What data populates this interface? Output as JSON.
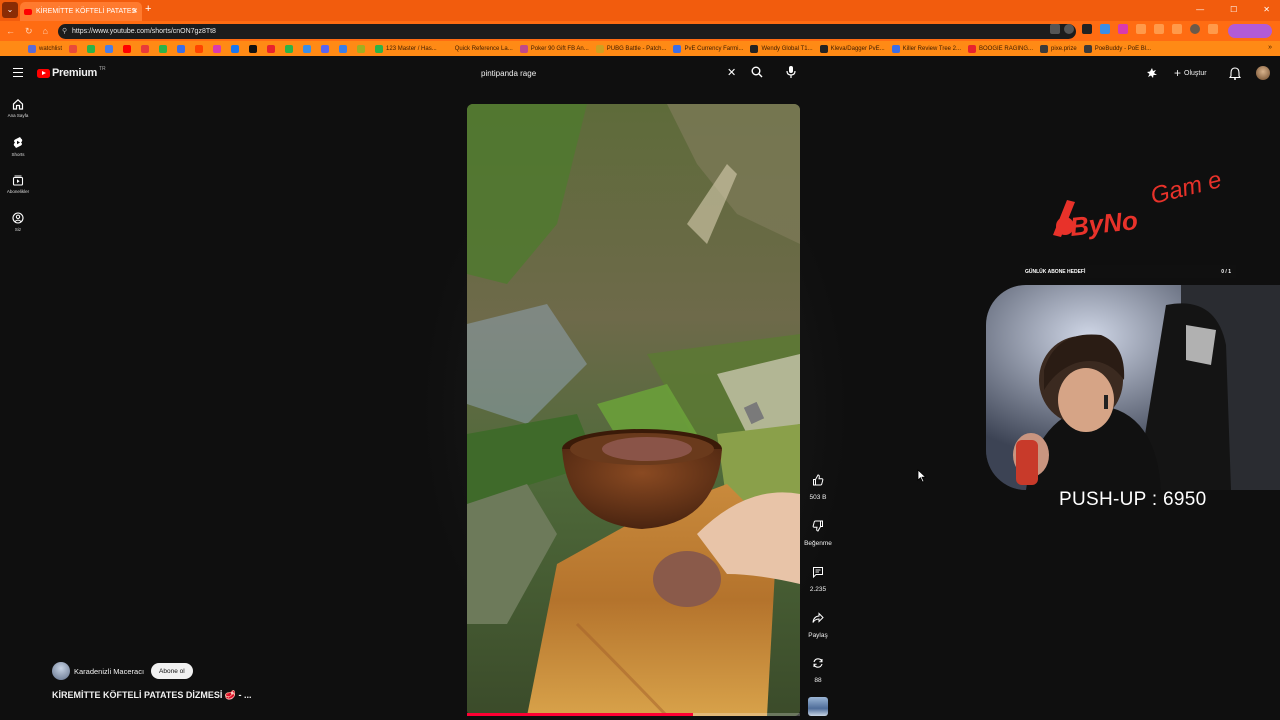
{
  "browser": {
    "tab_title": "KİREMİTTE KÖFTELİ PATATES",
    "url": "https://www.youtube.com/shorts/cnON7gz8Tt8",
    "bookmarks": [
      {
        "label": "watchlist",
        "color": "#5b6bd6"
      },
      {
        "label": "",
        "color": "#e84a3a"
      },
      {
        "label": "",
        "color": "#2bb34a"
      },
      {
        "label": "",
        "color": "#4a7ee8"
      },
      {
        "label": "",
        "color": "#ff0000"
      },
      {
        "label": "",
        "color": "#e83a3a"
      },
      {
        "label": "",
        "color": "#2bb34a"
      },
      {
        "label": "",
        "color": "#3a6ee8"
      },
      {
        "label": "",
        "color": "#ff4400"
      },
      {
        "label": "",
        "color": "#d93ab0"
      },
      {
        "label": "",
        "color": "#1877f2"
      },
      {
        "label": "",
        "color": "#111111"
      },
      {
        "label": "",
        "color": "#e8222e"
      },
      {
        "label": "",
        "color": "#2bb34a"
      },
      {
        "label": "",
        "color": "#3a8ee8"
      },
      {
        "label": "",
        "color": "#5865f2"
      },
      {
        "label": "",
        "color": "#3a7ee8"
      },
      {
        "label": "",
        "color": "#a0b020"
      },
      {
        "label": "123 Master / Has...",
        "color": "#2bb34a"
      },
      {
        "label": "Quick Reference La...",
        "color": "#ff8a15"
      },
      {
        "label": "Poker 90 Gift FB An...",
        "color": "#c04a8a"
      },
      {
        "label": "PUBG Battle - Patch...",
        "color": "#d0a020"
      },
      {
        "label": "PvE Currency Farmi...",
        "color": "#3a6ee8"
      },
      {
        "label": "Wendy Global T1...",
        "color": "#222222"
      },
      {
        "label": "Kleva/Dagger PvE...",
        "color": "#222222"
      },
      {
        "label": "Killer Review Tree 2...",
        "color": "#3a6ee8"
      },
      {
        "label": "BOOGIE RAGING...",
        "color": "#e8222e"
      },
      {
        "label": "pixe.prize",
        "color": "#3a3a3a"
      },
      {
        "label": "PoeBuddy - PoE Bl...",
        "color": "#3a3a3a"
      }
    ]
  },
  "header": {
    "logo_text": "Premium",
    "logo_badge": "TR",
    "search_value": "pintipanda rage",
    "create_label": "Oluştur"
  },
  "sidebar": {
    "items": [
      {
        "label": "Ana Sayfa",
        "icon": "home-icon"
      },
      {
        "label": "Shorts",
        "icon": "shorts-icon"
      },
      {
        "label": "Abonelikler",
        "icon": "subscriptions-icon"
      },
      {
        "label": "Siz",
        "icon": "you-icon"
      }
    ]
  },
  "short": {
    "channel_name": "Karadenizli Maceracı",
    "subscribe_label": "Abone ol",
    "title": "KİREMİTTE KÖFTELİ PATATES DİZMESİ 🥩 - ...",
    "progress_fraction": 0.68,
    "actions": {
      "likes": "503 B",
      "dislike_label": "Beğenme",
      "comments": "2.235",
      "share_label": "Paylaş",
      "remix_count": "88"
    }
  },
  "stream_overlay": {
    "logo_text_main": "ByNo",
    "logo_text_script": "Gam e",
    "goal_label": "GÜNLÜK ABONE HEDEFİ",
    "goal_count": "0 / 1",
    "pushup_text": "PUSH-UP : 6950"
  },
  "colors": {
    "browser_accent": "#ff6c12",
    "youtube_red": "#ff0000",
    "overlay_red": "#e8322a",
    "background": "#0f0f0f"
  }
}
